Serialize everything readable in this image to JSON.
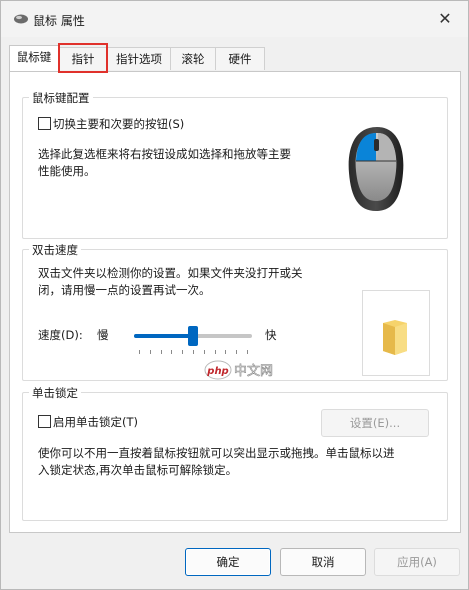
{
  "window": {
    "title": "鼠标 属性",
    "close_icon": "close-icon"
  },
  "tabs": [
    "鼠标键",
    "指针",
    "指针选项",
    "滚轮",
    "硬件"
  ],
  "active_tab": "鼠标键",
  "highlight_color": "#e0312b",
  "accent_color": "#0067c0",
  "button_config": {
    "title": "鼠标键配置",
    "checkbox_label": "切换主要和次要的按钮(S)",
    "checked": false,
    "description_line1": "选择此复选框来将右按钮设成如选择和拖放等主要",
    "description_line2": "性能使用。"
  },
  "double_click": {
    "title": "双击速度",
    "description_line1": "双击文件夹以检测你的设置。如果文件夹没打开或关",
    "description_line2": "闭，请用慢一点的设置再试一次。",
    "speed_label": "速度(D):",
    "slow_label": "慢",
    "fast_label": "快",
    "speed_value": 0.5
  },
  "click_lock": {
    "title": "单击锁定",
    "checkbox_label": "启用单击锁定(T)",
    "checked": false,
    "settings_label": "设置(E)...",
    "description_line1": "使你可以不用一直按着鼠标按钮就可以突出显示或拖拽。单击鼠标以进",
    "description_line2": "入锁定状态,再次单击鼠标可解除锁定。"
  },
  "watermark": {
    "badge": "php",
    "text": "中文网"
  },
  "footer": {
    "ok_label": "确定",
    "cancel_label": "取消",
    "apply_label": "应用(A)"
  }
}
